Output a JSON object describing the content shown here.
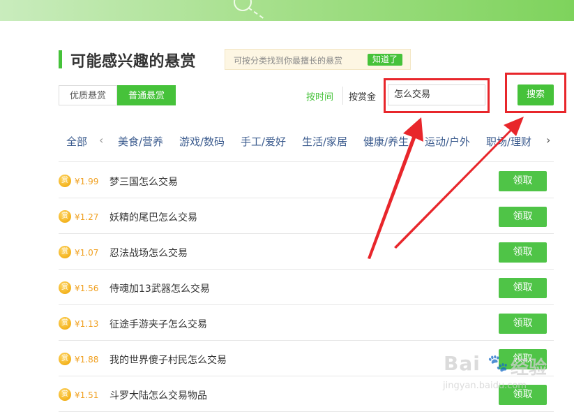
{
  "header": {
    "title": "可能感兴趣的悬赏",
    "tip": {
      "text": "可按分类找到你最擅长的悬赏",
      "button": "知道了"
    }
  },
  "tabs": [
    {
      "label": "优质悬赏",
      "active": false
    },
    {
      "label": "普通悬赏",
      "active": true
    }
  ],
  "sort": {
    "by_time": "按时间",
    "by_reward": "按赏金"
  },
  "search": {
    "value": "怎么交易",
    "button": "搜索"
  },
  "categories": [
    "全部",
    "美食/营养",
    "游戏/数码",
    "手工/爱好",
    "生活/家居",
    "健康/养生",
    "运动/户外",
    "职场/理财"
  ],
  "items": [
    {
      "coin": "赏",
      "amount": "¥1.99",
      "title": "梦三国怎么交易",
      "action": "领取"
    },
    {
      "coin": "赏",
      "amount": "¥1.27",
      "title": "妖精的尾巴怎么交易",
      "action": "领取"
    },
    {
      "coin": "赏",
      "amount": "¥1.07",
      "title": "忍法战场怎么交易",
      "action": "领取"
    },
    {
      "coin": "赏",
      "amount": "¥1.56",
      "title": "侍魂加13武器怎么交易",
      "action": "领取"
    },
    {
      "coin": "赏",
      "amount": "¥1.13",
      "title": "征途手游夹子怎么交易",
      "action": "领取"
    },
    {
      "coin": "赏",
      "amount": "¥1.88",
      "title": "我的世界傻子村民怎么交易",
      "action": "领取"
    },
    {
      "coin": "赏",
      "amount": "¥1.51",
      "title": "斗罗大陆怎么交易物品",
      "action": "领取"
    }
  ],
  "watermark": {
    "logo": "Bai",
    "paw": "🐾",
    "brand": "经验",
    "url": "jingyan.baidu.com"
  },
  "colors": {
    "accent": "#46c23a",
    "highlight": "#e8262b",
    "link": "#3b5b8e",
    "amount": "#f0a020"
  }
}
